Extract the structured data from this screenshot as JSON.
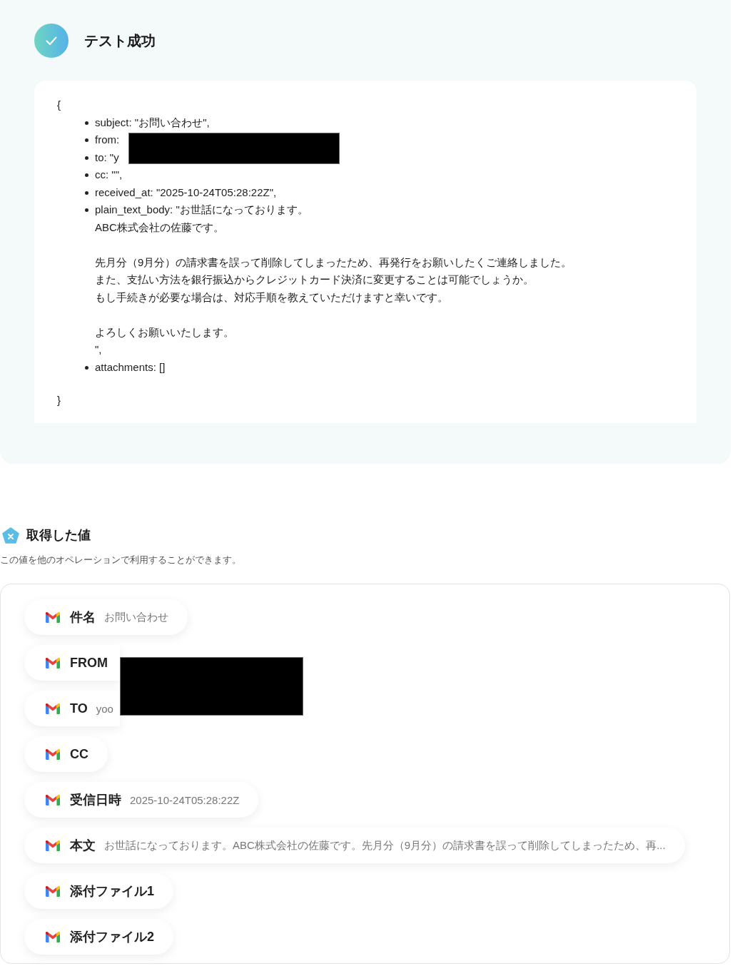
{
  "test_result": {
    "title": "テスト成功"
  },
  "test_output": {
    "open_brace": "{",
    "lines": [
      {
        "paragraphs": [
          [
            "subject: \"お問い合わせ\","
          ]
        ],
        "redacted": false
      },
      {
        "paragraphs": [
          [
            "from:"
          ]
        ],
        "redacted": true
      },
      {
        "paragraphs": [
          [
            "to: \"y"
          ]
        ],
        "redacted": true
      },
      {
        "paragraphs": [
          [
            "cc: \"\","
          ]
        ],
        "redacted": false
      },
      {
        "paragraphs": [
          [
            "received_at: \"2025-10-24T05:28:22Z\","
          ]
        ],
        "redacted": false
      },
      {
        "paragraphs": [
          [
            "plain_text_body: \"お世話になっております。",
            "ABC株式会社の佐藤です。"
          ],
          [
            "先月分（9月分）の請求書を誤って削除してしまったため、再発行をお願いしたくご連絡しました。",
            "また、支払い方法を銀行振込からクレジットカード決済に変更することは可能でしょうか。",
            "もし手続きが必要な場合は、対応手順を教えていただけますと幸いです。"
          ],
          [
            "よろしくお願いいたします。",
            "\","
          ]
        ],
        "redacted": false
      },
      {
        "paragraphs": [
          [
            "attachments: []"
          ]
        ],
        "redacted": false
      }
    ],
    "close_brace": "}"
  },
  "extracted_values": {
    "title": "取得した値",
    "description": "この値を他のオペレーションで利用することができます。",
    "items": [
      {
        "label": "件名",
        "value": "お問い合わせ",
        "redacted": false
      },
      {
        "label": "FROM",
        "redacted": true
      },
      {
        "label": "TO",
        "value": "yoo",
        "redacted": true
      },
      {
        "label": "CC",
        "redacted": false
      },
      {
        "label": "受信日時",
        "value": "2025-10-24T05:28:22Z",
        "redacted": false
      },
      {
        "label": "本文",
        "value": "お世話になっております。ABC株式会社の佐藤です。先月分（9月分）の請求書を誤って削除してしまったため、再...",
        "redacted": false
      },
      {
        "label": "添付ファイル1",
        "redacted": false
      },
      {
        "label": "添付ファイル2",
        "redacted": false
      }
    ]
  }
}
